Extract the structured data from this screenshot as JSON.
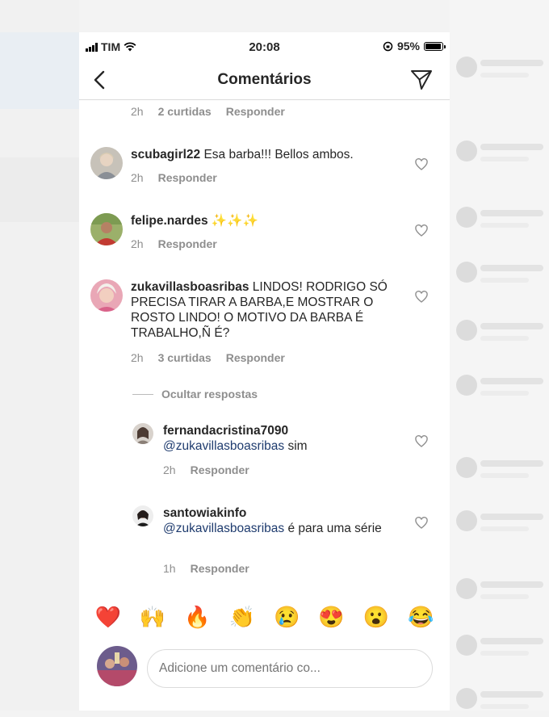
{
  "status_bar": {
    "carrier": "TIM",
    "time": "20:08",
    "battery": "95%",
    "battery_level": 0.95
  },
  "header": {
    "title": "Comentários"
  },
  "top_meta": {
    "time": "2h",
    "likes": "2 curtidas",
    "reply": "Responder"
  },
  "comments": [
    {
      "username": "scubagirl22",
      "text": " Esa barba!!! Bellos ambos.",
      "time": "2h",
      "reply": "Responder"
    },
    {
      "username": "felipe.nardes",
      "text": " ✨✨✨",
      "time": "2h",
      "reply": "Responder"
    },
    {
      "username": "zukavillasboasribas",
      "text": " LINDOS! RODRIGO SÓ PRECISA TIRAR A BARBA,E MOSTRAR O ROSTO LINDO! O MOTIVO DA BARBA É TRABALHO,Ñ É?",
      "time": "2h",
      "likes": "3 curtidas",
      "reply": "Responder"
    }
  ],
  "hide_replies": "Ocultar respostas",
  "replies": [
    {
      "username": "fernandacristina7090",
      "mention": "@zukavillasboasribas",
      "text": " sim",
      "time": "2h",
      "reply": "Responder"
    },
    {
      "username": "santowiakinfo",
      "mention": "@zukavillasboasribas",
      "text": " é para uma série",
      "time": "1h",
      "reply": "Responder"
    }
  ],
  "emoji_reactions": [
    "❤️",
    "🙌",
    "🔥",
    "👏",
    "😢",
    "😍",
    "😮",
    "😂"
  ],
  "composer": {
    "placeholder": "Adicione um comentário co..."
  },
  "colors": {
    "mention": "#1e3b6e",
    "secondary_text": "#8e8e8e",
    "divider": "#dbdbdb"
  }
}
